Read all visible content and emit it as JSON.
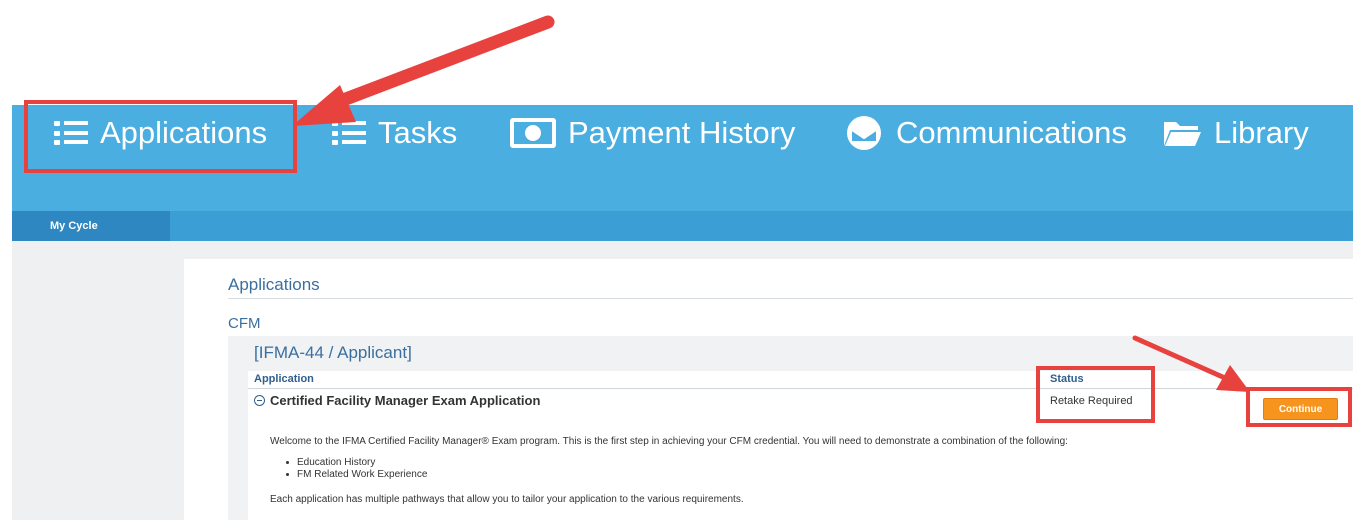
{
  "nav": {
    "items": [
      {
        "label": "Applications",
        "icon": "list-icon"
      },
      {
        "label": "Tasks",
        "icon": "list-icon"
      },
      {
        "label": "Payment History",
        "icon": "money-icon"
      },
      {
        "label": "Communications",
        "icon": "envelope-icon"
      },
      {
        "label": "Library",
        "icon": "folder-icon"
      }
    ]
  },
  "subnav": {
    "my_cycle": "My Cycle"
  },
  "page": {
    "title": "Applications",
    "section": "CFM",
    "panel_title": "[IFMA-44 / Applicant]",
    "columns": {
      "application": "Application",
      "status": "Status"
    },
    "row": {
      "name": "Certified Facility Manager Exam Application",
      "status": "Retake Required",
      "action": "Continue"
    },
    "description": {
      "intro": "Welcome to the IFMA Certified Facility Manager® Exam program. This is the first step in achieving your CFM credential. You will need to demonstrate a combination of the following:",
      "bullets": [
        "Education History",
        "FM Related Work Experience"
      ],
      "outro": "Each application has multiple pathways that allow you to tailor your application to the various requirements."
    }
  },
  "colors": {
    "nav_bg": "#4aaee0",
    "subbar_bg": "#3b9fd6",
    "accent_orange": "#f7941d",
    "annotation_red": "#e8423f",
    "link_blue": "#3a6fa0"
  }
}
